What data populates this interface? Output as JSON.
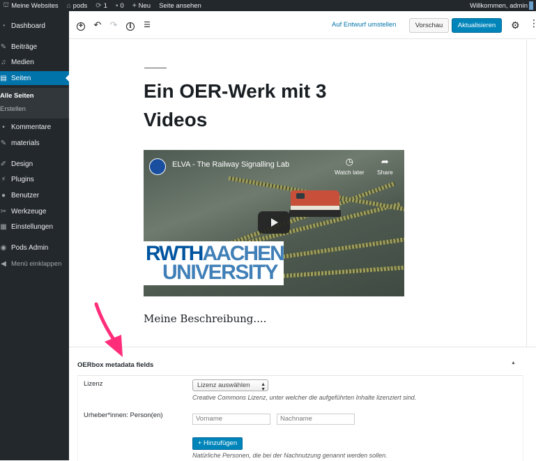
{
  "adminbar": {
    "sites": "Meine Websites",
    "site_name": "pods",
    "updates": "1",
    "comments": "0",
    "new": "Neu",
    "view_site": "Seite ansehen",
    "welcome": "Willkommen, admin"
  },
  "sidebar": {
    "dashboard": "Dashboard",
    "posts": "Beiträge",
    "media": "Medien",
    "pages": "Seiten",
    "sub_all_pages": "Alle Seiten",
    "sub_create": "Erstellen",
    "comments": "Kommentare",
    "materials": "materials",
    "design": "Design",
    "plugins": "Plugins",
    "users": "Benutzer",
    "tools": "Werkzeuge",
    "settings": "Einstellungen",
    "pods_admin": "Pods Admin",
    "collapse": "Menü einklappen"
  },
  "toolbar": {
    "switch_to_draft": "Auf Entwurf umstellen",
    "preview": "Vorschau",
    "update": "Aktualisieren"
  },
  "post": {
    "title": "Ein OER-Werk mit 3 Videos",
    "description": "Meine Beschreibung...."
  },
  "video": {
    "title": "ELVA - The Railway Signalling Lab",
    "watch_later": "Watch later",
    "share": "Share",
    "logo_line1_a": "RWTH",
    "logo_line1_b": "AACHEN",
    "logo_line2": "UNIVERSITY"
  },
  "metabox": {
    "title": "OERbox metadata fields",
    "license_label": "Lizenz",
    "license_select": "Lizenz auswählen",
    "license_help": "Creative Commons Lizenz, unter welcher die aufgeführten Inhalte lizenziert sind.",
    "author_label": "Urheber*innen: Person(en)",
    "firstname_placeholder": "Vorname",
    "lastname_placeholder": "Nachname",
    "add_button": "+ Hinzufügen",
    "author_help": "Natürliche Personen, die bei der Nachnutzung genannt werden sollen."
  },
  "colors": {
    "admin_dark": "#23282d",
    "wp_blue": "#0073aa",
    "button_blue": "#0085ba",
    "annotation_pink": "#ff2d7a"
  }
}
